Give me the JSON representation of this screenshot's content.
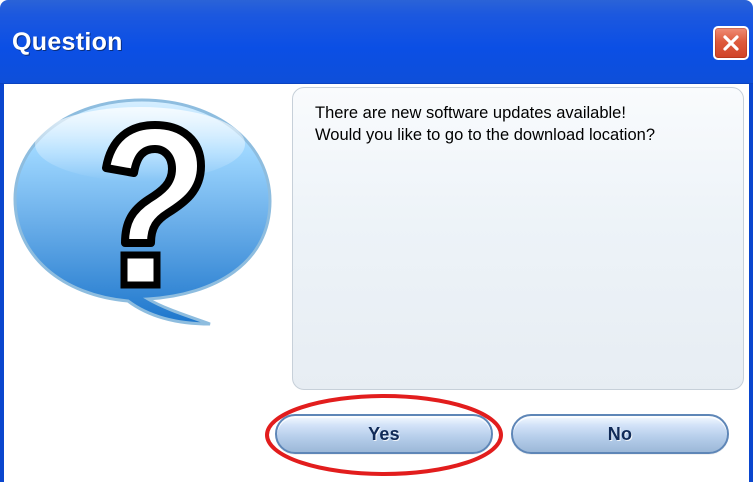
{
  "dialog": {
    "title": "Question",
    "message": "There are new software updates available! Would you like to go to the download location?",
    "buttons": {
      "yes_label": "Yes",
      "no_label": "No"
    },
    "icons": {
      "close": "close-icon",
      "question": "question-bubble-icon"
    },
    "colors": {
      "titlebar": "#0b4fe5",
      "close_button": "#d04326",
      "button_fill": "#b5cdea",
      "button_border": "#5e86b7",
      "message_panel": "#edf3f8",
      "question_bubble": "#75bdf1",
      "highlight": "#e21d1d"
    }
  }
}
